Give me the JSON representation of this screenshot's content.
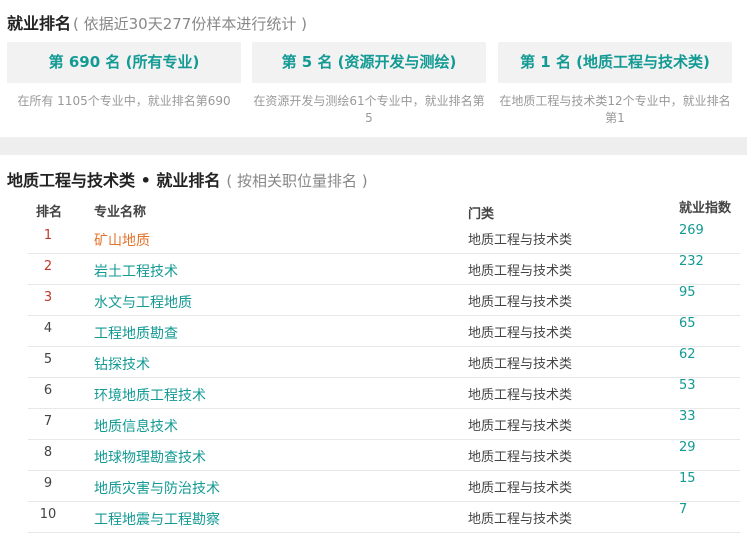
{
  "overall": {
    "title": "就业排名",
    "subtitle": "( 依据近30天277份样本进行统计 )",
    "cards": [
      {
        "label": "第 690 名 (所有专业)",
        "note": "在所有 1105个专业中，就业排名第690"
      },
      {
        "label": "第 5 名 (资源开发与测绘)",
        "note": "在资源开发与测绘61个专业中，就业排名第5"
      },
      {
        "label": "第 1 名 (地质工程与技术类)",
        "note": "在地质工程与技术类12个专业中，就业排名第1"
      }
    ]
  },
  "ranking": {
    "title": "地质工程与技术类 • 就业排名",
    "subtitle": "( 按相关职位量排名 )",
    "headers": {
      "rank": "排名",
      "name": "专业名称",
      "category": "门类",
      "index": "就业指数"
    },
    "rows": [
      {
        "rank": "1",
        "name": "矿山地质",
        "category": "地质工程与技术类",
        "index": "269"
      },
      {
        "rank": "2",
        "name": "岩土工程技术",
        "category": "地质工程与技术类",
        "index": "232"
      },
      {
        "rank": "3",
        "name": "水文与工程地质",
        "category": "地质工程与技术类",
        "index": "95"
      },
      {
        "rank": "4",
        "name": "工程地质勘查",
        "category": "地质工程与技术类",
        "index": "65"
      },
      {
        "rank": "5",
        "name": "钻探技术",
        "category": "地质工程与技术类",
        "index": "62"
      },
      {
        "rank": "6",
        "name": "环境地质工程技术",
        "category": "地质工程与技术类",
        "index": "53"
      },
      {
        "rank": "7",
        "name": "地质信息技术",
        "category": "地质工程与技术类",
        "index": "33"
      },
      {
        "rank": "8",
        "name": "地球物理勘查技术",
        "category": "地质工程与技术类",
        "index": "29"
      },
      {
        "rank": "9",
        "name": "地质灾害与防治技术",
        "category": "地质工程与技术类",
        "index": "15"
      },
      {
        "rank": "10",
        "name": "工程地震与工程勘察",
        "category": "地质工程与技术类",
        "index": "7"
      }
    ]
  },
  "colors": {
    "accent": "#139a94",
    "highlight": "#e4742c",
    "top_rank": "#c0392b"
  }
}
